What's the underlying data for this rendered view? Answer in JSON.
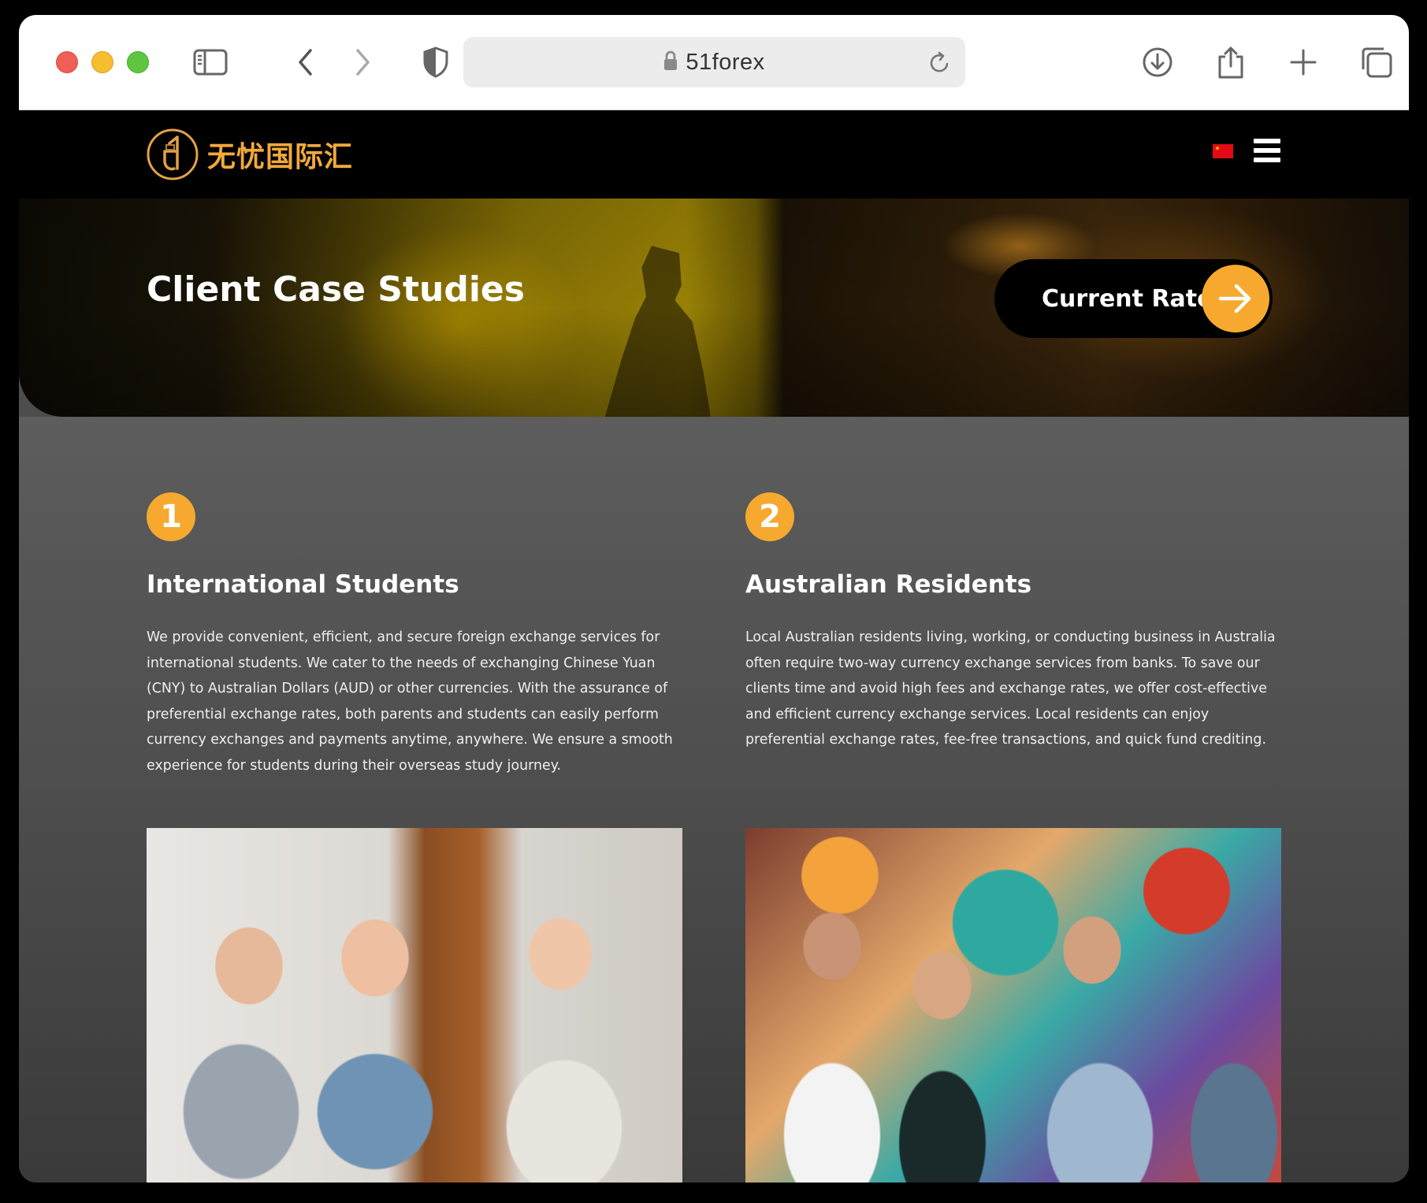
{
  "browser": {
    "url": "51forex"
  },
  "header": {
    "logo_text": "无忧国际汇"
  },
  "hero": {
    "title": "Client Case Studies",
    "cta_label": "Current Rates"
  },
  "cards": [
    {
      "number": "1",
      "title": "International Students",
      "text": "We provide convenient, efficient, and secure foreign exchange services for international students. We cater to the needs of exchanging Chinese Yuan (CNY) to Australian Dollars (AUD) or other currencies. With the assurance of preferential exchange rates, both parents and students can easily perform currency exchanges and payments anytime, anywhere. We ensure a smooth experience for students during their overseas study journey."
    },
    {
      "number": "2",
      "title": "Australian Residents",
      "text": "Local Australian residents living, working, or conducting business in Australia often require two-way currency exchange services from banks. To save our clients time and avoid high fees and exchange rates, we offer cost-effective and efficient currency exchange services. Local residents can enjoy preferential exchange rates, fee-free transactions, and quick fund crediting."
    }
  ],
  "colors": {
    "accent": "#f6a92e",
    "header_bg": "#000000",
    "content_bg": "#4d4d4d"
  },
  "icons": [
    "sidebar-icon",
    "back-icon",
    "forward-icon",
    "shield-icon",
    "lock-icon",
    "reload-icon",
    "download-icon",
    "share-icon",
    "new-tab-icon",
    "tabs-icon",
    "china-flag-icon",
    "menu-icon",
    "arrow-right-icon"
  ]
}
